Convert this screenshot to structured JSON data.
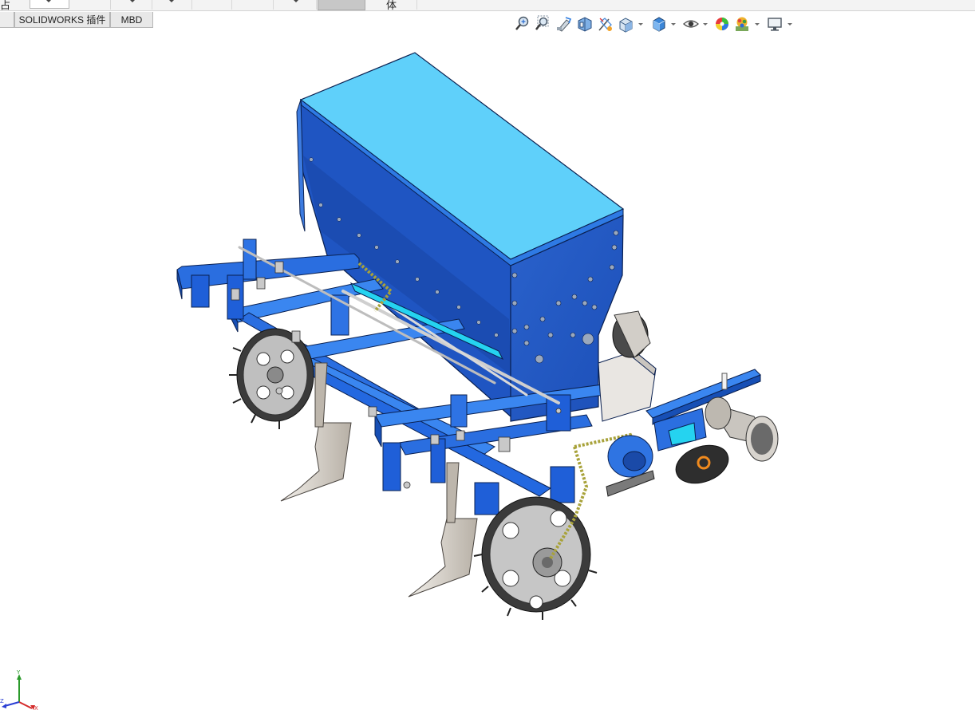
{
  "ribbon": {
    "tabs": [
      {
        "label": "SOLIDWORKS 插件"
      },
      {
        "label": "MBD"
      }
    ],
    "left_fragment": "占",
    "body_fragment": "体"
  },
  "heads_up_toolbar": {
    "buttons": [
      {
        "icon": "zoom-to-fit-icon"
      },
      {
        "icon": "zoom-to-area-icon"
      },
      {
        "icon": "previous-view-icon"
      },
      {
        "icon": "section-view-icon"
      },
      {
        "icon": "dynamic-annotation-icon"
      },
      {
        "icon": "view-orientation-icon"
      },
      {
        "icon": "display-style-icon"
      },
      {
        "icon": "hide-show-items-icon"
      },
      {
        "icon": "edit-appearance-icon"
      },
      {
        "icon": "apply-scene-icon"
      },
      {
        "icon": "view-settings-icon"
      }
    ]
  },
  "triad": {
    "x_label": "X",
    "y_label": "Y",
    "z_label": "Z"
  },
  "colors": {
    "hopper_top": "#5fd1fb",
    "hopper_front": "#2a5fc4",
    "hopper_side": "#1e56c8",
    "frame_blue": "#1f63d8",
    "frame_light": "#3a86f0",
    "metal_grey": "#c9c4bd",
    "wheel_dark": "#2e2e2e",
    "chain_gold": "#a8a23a",
    "accent_orange": "#f08a1e"
  }
}
